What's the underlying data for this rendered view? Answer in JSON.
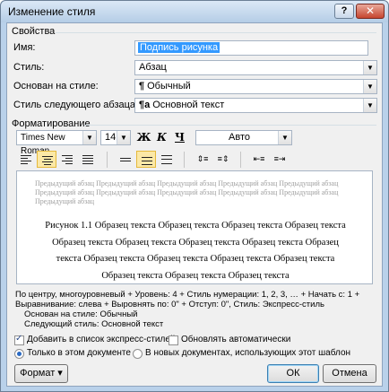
{
  "window": {
    "title": "Изменение стиля",
    "help_label": "?",
    "close_label": "✕"
  },
  "properties": {
    "section_label": "Свойства",
    "name": {
      "label": "Имя:",
      "value": "Подпись рисунка"
    },
    "style_type": {
      "label": "Стиль:",
      "value": "Абзац"
    },
    "based_on": {
      "label": "Основан на стиле:",
      "value": "Обычный",
      "icon": "¶"
    },
    "next_style": {
      "label": "Стиль следующего абзаца:",
      "value": "Основной текст",
      "icon": "¶a"
    }
  },
  "formatting": {
    "section_label": "Форматирование",
    "font": "Times New Roman",
    "size": "14",
    "bold": "Ж",
    "italic": "К",
    "underline": "Ч",
    "color": "Авто"
  },
  "preview": {
    "prev_paragraph": "Предыдущий абзац Предыдущий абзац Предыдущий абзац Предыдущий абзац Предыдущий абзац Предыдущий абзац Предыдущий абзац Предыдущий абзац Предыдущий абзац Предыдущий абзац Предыдущий абзац",
    "lines": [
      "Рисунок 1.1 Образец текста Образец текста Образец текста Образец текста",
      "Образец текста Образец текста Образец текста Образец текста Образец",
      "текста Образец текста Образец текста Образец текста Образец текста",
      "Образец текста Образец текста Образец текста"
    ]
  },
  "description": {
    "line1": "По центру, многоуровневый + Уровень: 4 + Стиль нумерации: 1, 2, 3, … + Начать с: 1 +",
    "line2": "Выравнивание: слева + Выровнять по:  0\" + Отступ:  0\", Стиль: Экспресс-стиль",
    "line3": "Основан на стиле: Обычный",
    "line4": "Следующий стиль: Основной текст"
  },
  "options": {
    "add_to_quick": "Добавить в список экспресс-стилей",
    "auto_update": "Обновлять автоматически",
    "only_this_doc": "Только в этом документе",
    "new_docs": "В новых документах, использующих этот шаблон"
  },
  "buttons": {
    "format": "Формат ▾",
    "ok": "ОК",
    "cancel": "Отмена"
  },
  "colors": {
    "accent": "#3399ff",
    "title_bg": "#b9d1ea",
    "selected_align": "#fbe8a6"
  }
}
